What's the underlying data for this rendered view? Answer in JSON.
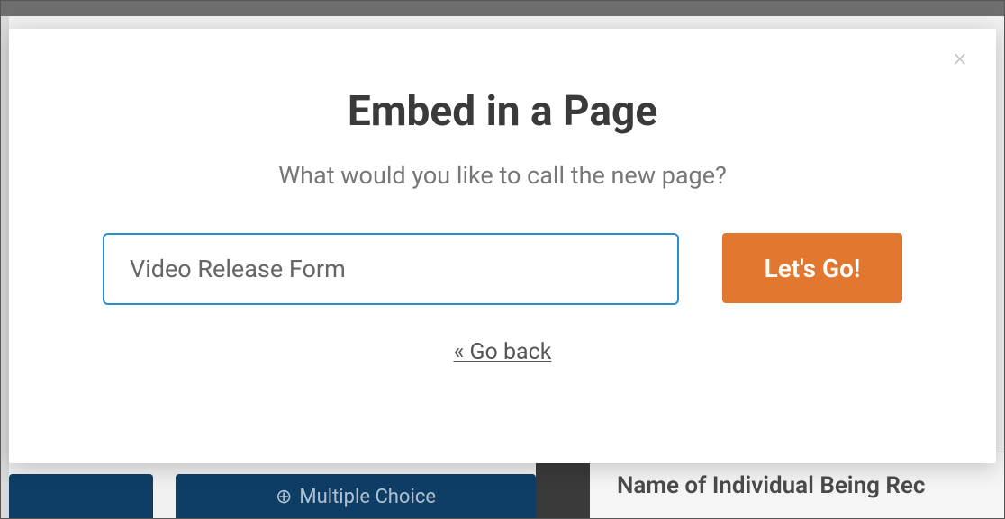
{
  "modal": {
    "title": "Embed in a Page",
    "subtitle": "What would you like to call the new page?",
    "input_value": "Video Release Form",
    "go_button_label": "Let's Go!",
    "go_back_label": "« Go back"
  },
  "background": {
    "button2_label": "Multiple Choice",
    "right_panel_text": "Name of Individual Being Rec"
  },
  "colors": {
    "primary_button": "#e27730",
    "input_border": "#2a8fc9",
    "bg_button": "#0e3e66"
  }
}
